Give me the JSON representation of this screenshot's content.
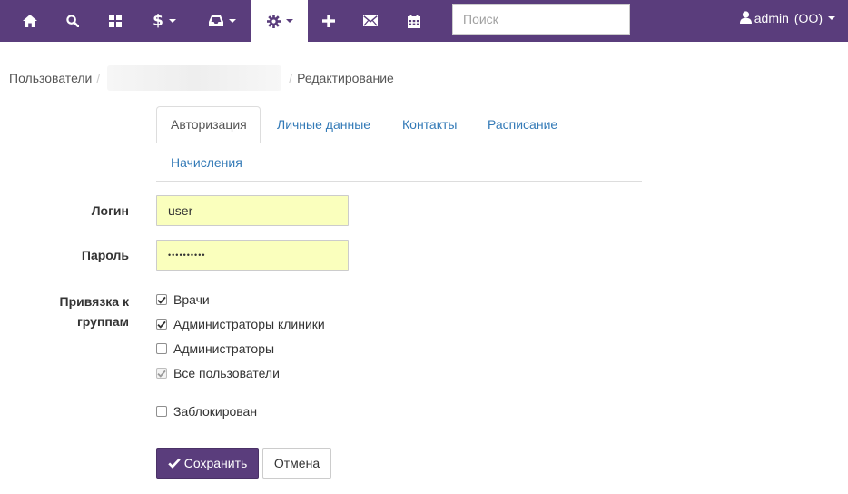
{
  "navbar": {
    "icons": [
      "home-icon",
      "search-icon",
      "dashboard-icon",
      "dollar-icon",
      "inbox-icon",
      "gear-icon",
      "plus-icon",
      "envelope-icon",
      "calendar-icon"
    ],
    "dollar_glyph": "$",
    "search_placeholder": "Поиск",
    "user": {
      "name": "admin",
      "role": "(ОО)"
    },
    "colors": {
      "background": "#5a3d7c",
      "active": "#ffffff"
    }
  },
  "breadcrumb": {
    "items": [
      "Пользователи",
      "",
      "Редактирование"
    ],
    "separator": "/"
  },
  "tabs": [
    {
      "label": "Авторизация",
      "active": true
    },
    {
      "label": "Личные данные",
      "active": false
    },
    {
      "label": "Контакты",
      "active": false
    },
    {
      "label": "Расписание",
      "active": false
    },
    {
      "label": "Начисления",
      "active": false
    }
  ],
  "form": {
    "login": {
      "label": "Логин",
      "value": "user"
    },
    "password": {
      "label": "Пароль",
      "value": "••••••••••"
    },
    "groups": {
      "label_line1": "Привязка к",
      "label_line2": "группам",
      "options": [
        {
          "label": "Врачи",
          "checked": true,
          "disabled": false
        },
        {
          "label": "Администраторы клиники",
          "checked": true,
          "disabled": false
        },
        {
          "label": "Администраторы",
          "checked": false,
          "disabled": false
        },
        {
          "label": "Все пользователи",
          "checked": true,
          "disabled": true
        }
      ]
    },
    "blocked": {
      "label": "Заблокирован",
      "checked": false
    }
  },
  "buttons": {
    "save": "Сохранить",
    "cancel": "Отмена"
  },
  "colors": {
    "primary": "#5a3d7c",
    "link": "#337ab7",
    "autofill": "#faffbd"
  }
}
